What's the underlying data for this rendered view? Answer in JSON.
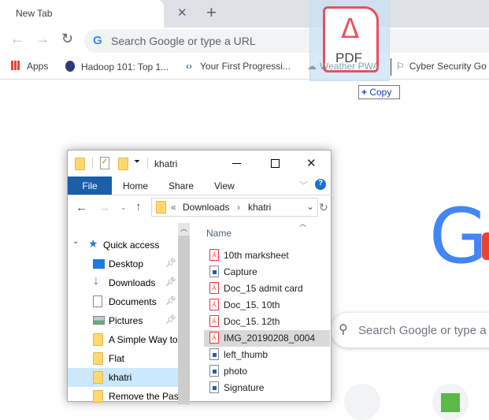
{
  "browser": {
    "tab": {
      "title": "New Tab",
      "close_icon": "close-icon"
    },
    "new_tab_icon": "plus-icon",
    "omnibox": {
      "placeholder": "Search Google or type a URL"
    },
    "bookmarks": [
      {
        "label": "Apps",
        "icon": "apps-grid-icon"
      },
      {
        "label": "Hadoop 101: Top 1...",
        "icon": "hadoop-icon"
      },
      {
        "label": "Your First Progressi...",
        "icon": "code-icon"
      },
      {
        "label": "Weather PWA",
        "icon": "weather-icon"
      },
      {
        "label": "Cyber Security Go",
        "icon": "flag-icon"
      }
    ]
  },
  "drag": {
    "file_type": "PDF",
    "effect_label": "Copy",
    "effect_icon": "plus-icon"
  },
  "newtab": {
    "logo_letter": "G",
    "search_placeholder": "Search Google or type a"
  },
  "explorer": {
    "title": "khatri",
    "ribbon_tabs": [
      "File",
      "Home",
      "Share",
      "View"
    ],
    "breadcrumb": [
      "«",
      "Downloads",
      "›",
      "khatri"
    ],
    "nav": [
      {
        "label": "Quick access",
        "icon": "star-icon",
        "pinned": false
      },
      {
        "label": "Desktop",
        "icon": "desktop-icon",
        "pinned": true
      },
      {
        "label": "Downloads",
        "icon": "download-arrow-icon",
        "pinned": true
      },
      {
        "label": "Documents",
        "icon": "document-icon",
        "pinned": true
      },
      {
        "label": "Pictures",
        "icon": "pictures-icon",
        "pinned": true
      },
      {
        "label": "A Simple Way to",
        "icon": "folder-icon",
        "pinned": false
      },
      {
        "label": "Flat",
        "icon": "folder-icon",
        "pinned": false
      },
      {
        "label": "khatri",
        "icon": "folder-icon",
        "pinned": false,
        "selected": true
      },
      {
        "label": "Remove the Pas",
        "icon": "folder-icon",
        "pinned": false
      }
    ],
    "column_header": "Name",
    "files": [
      {
        "name": "10th marksheet",
        "type": "pdf"
      },
      {
        "name": "Capture",
        "type": "image"
      },
      {
        "name": "Doc_15 admit card",
        "type": "pdf"
      },
      {
        "name": "Doc_15. 10th",
        "type": "pdf"
      },
      {
        "name": "Doc_15. 12th",
        "type": "pdf"
      },
      {
        "name": "IMG_20190208_0004",
        "type": "pdf",
        "selected": true
      },
      {
        "name": "left_thumb",
        "type": "image"
      },
      {
        "name": "photo",
        "type": "image"
      },
      {
        "name": "Signature",
        "type": "image"
      }
    ],
    "colors": {
      "file_tab": "#1a5fa8",
      "selected_nav": "#cce8ff",
      "selected_file": "#d9d9d9"
    }
  }
}
